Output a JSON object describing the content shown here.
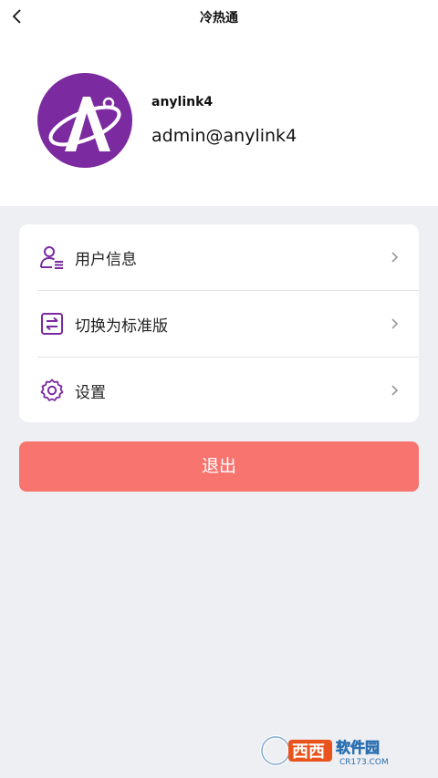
{
  "nav": {
    "title": "冷热通",
    "back_icon": "chevron-left-icon"
  },
  "profile": {
    "username": "anylink4",
    "email": "admin@anylink4",
    "avatar_letter": "A"
  },
  "menu": {
    "items": [
      {
        "label": "用户信息",
        "icon": "user-info-icon"
      },
      {
        "label": "切换为标准版",
        "icon": "switch-icon"
      },
      {
        "label": "设置",
        "icon": "gear-icon"
      }
    ]
  },
  "logout_label": "退出",
  "watermark": {
    "text": "西西软件园",
    "sub": "CR173.COM"
  },
  "colors": {
    "accent": "#7b2aa0",
    "logout": "#f8746f",
    "background": "#eeeff3",
    "card": "#ffffff"
  }
}
